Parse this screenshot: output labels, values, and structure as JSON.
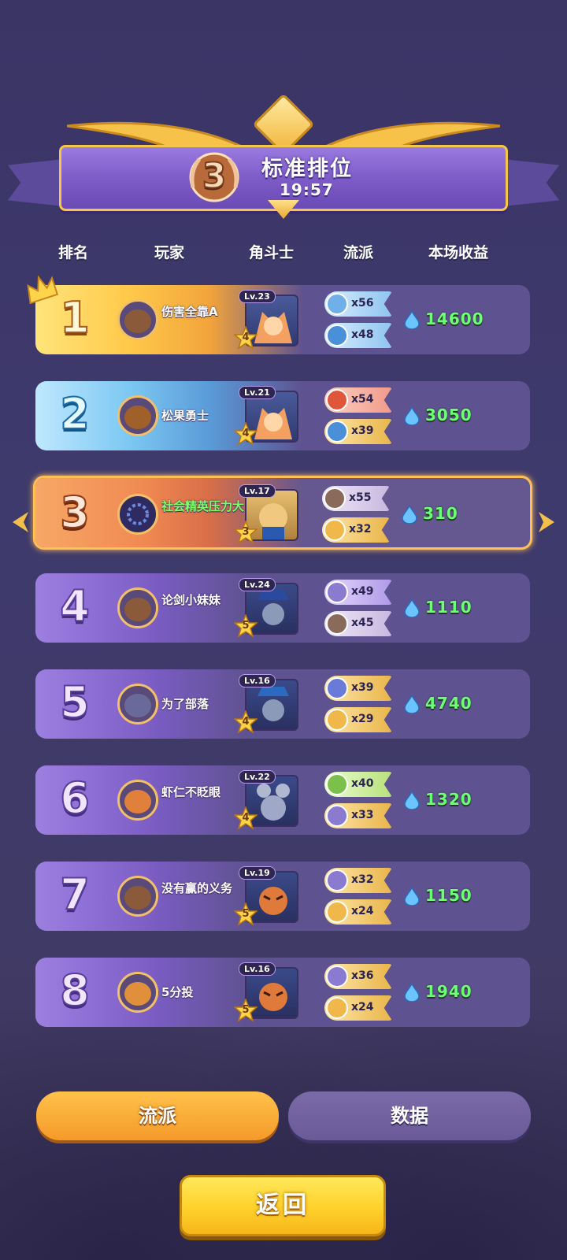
{
  "banner": {
    "rank": "3",
    "title": "标准排位",
    "time": "19:57"
  },
  "header": {
    "rank": "排名",
    "player": "玩家",
    "gladiator": "角斗士",
    "school": "流派",
    "earnings": "本场收益"
  },
  "rows": [
    {
      "rank": "1",
      "name": "伤害全靠A",
      "lv": "Lv.23",
      "star": "4",
      "s1": {
        "icon": "snowflake-icon",
        "count": "x56"
      },
      "s2": {
        "icon": "water-drop-icon",
        "count": "x48"
      },
      "earn": "14600"
    },
    {
      "rank": "2",
      "name": "松果勇士",
      "lv": "Lv.21",
      "star": "4",
      "s1": {
        "icon": "fire-icon",
        "count": "x54"
      },
      "s2": {
        "icon": "water-drop-icon",
        "count": "x39"
      },
      "earn": "3050"
    },
    {
      "rank": "3",
      "name": "社会精英压力大",
      "lv": "Lv.17",
      "star": "3",
      "s1": {
        "icon": "shield-icon",
        "count": "x55"
      },
      "s2": {
        "icon": "heart-icon",
        "count": "x32"
      },
      "earn": "310"
    },
    {
      "rank": "4",
      "name": "论剑小妹妹",
      "lv": "Lv.24",
      "star": "5",
      "s1": {
        "icon": "sword-icon",
        "count": "x49"
      },
      "s2": {
        "icon": "shield-icon",
        "count": "x45"
      },
      "earn": "1110"
    },
    {
      "rank": "5",
      "name": "为了部落",
      "lv": "Lv.16",
      "star": "4",
      "s1": {
        "icon": "claw-icon",
        "count": "x39"
      },
      "s2": {
        "icon": "heart-icon",
        "count": "x29"
      },
      "earn": "4740"
    },
    {
      "rank": "6",
      "name": "虾仁不眨眼",
      "lv": "Lv.22",
      "star": "4",
      "s1": {
        "icon": "heal-cross-icon",
        "count": "x40"
      },
      "s2": {
        "icon": "sword-icon",
        "count": "x33"
      },
      "earn": "1320"
    },
    {
      "rank": "7",
      "name": "没有赢的义务",
      "lv": "Lv.19",
      "star": "5",
      "s1": {
        "icon": "sword-icon",
        "count": "x32"
      },
      "s2": {
        "icon": "heart-icon",
        "count": "x24"
      },
      "earn": "1150"
    },
    {
      "rank": "8",
      "name": "5分投",
      "lv": "Lv.16",
      "star": "5",
      "s1": {
        "icon": "sword-icon",
        "count": "x36"
      },
      "s2": {
        "icon": "heart-icon",
        "count": "x24"
      },
      "earn": "1940"
    }
  ],
  "tabs": {
    "school": "流派",
    "data": "数据"
  },
  "back_button": "返回",
  "colors": {
    "background": "#3f3a6d",
    "earn_text": "#6dff75",
    "self_name": "#7dff6a",
    "accent_gold": "#ffd12a"
  }
}
